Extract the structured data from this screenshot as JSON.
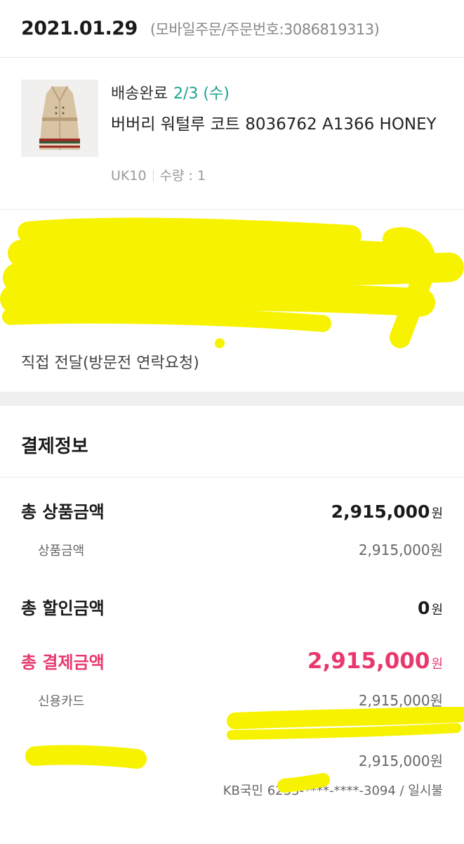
{
  "order": {
    "date": "2021.01.29",
    "meta": "(모바일주문/주문번호:3086819313)"
  },
  "product": {
    "status": "배송완료",
    "status_date": "2/3 (수)",
    "name": "버버리 워털루 코트 8036762 A1366 HONEY",
    "size": "UK10",
    "quantity": "수량 : 1"
  },
  "delivery": {
    "note": "직접 전달(방문전 연락요청)"
  },
  "payment": {
    "title": "결제정보",
    "total_goods_label": "총 상품금액",
    "total_goods_amount": "2,915,000",
    "goods_label": "상품금액",
    "goods_amount": "2,915,000원",
    "total_discount_label": "총 할인금액",
    "total_discount_amount": "0",
    "total_pay_label": "총 결제금액",
    "total_pay_amount": "2,915,000",
    "card_label": "신용카드",
    "card_amount": "2,915,000원",
    "second_amount": "2,915,000원",
    "card_info": "KB국민 6233-****-****-3094 / 일시불",
    "currency": "원"
  },
  "colors": {
    "accent": "#e8386d",
    "status_date": "#1aa38f",
    "redaction": "#f6f200"
  }
}
